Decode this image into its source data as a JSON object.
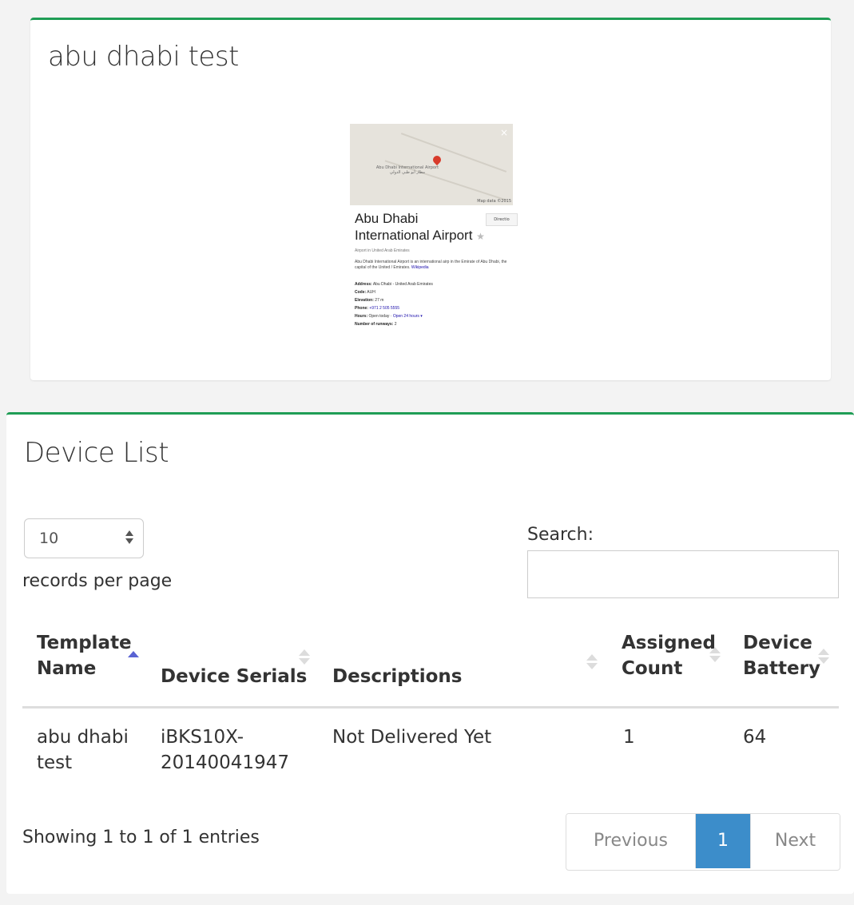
{
  "top_card": {
    "title": "abu dhabi test",
    "image": {
      "map_label": "Abu Dhabi International Airport",
      "map_label_ar": "مطار أبو ظبي الدولي",
      "map_data": "Map data ©2015",
      "close": "×",
      "name_line1": "Abu Dhabi",
      "name_line2": "International Airport",
      "star": "★",
      "directions": "Directio",
      "subtitle": "Airport in United Arab Emirates",
      "description": "Abu Dhabi International Airport is an international airp in the Emirate of Abu Dhabi, the capital of the United / Emirates.",
      "wiki": "Wikipedia",
      "address_label": "Address:",
      "address": "Abu Dhabi - United Arab Emirates",
      "code_label": "Code:",
      "code": "AUH",
      "elevation_label": "Elevation:",
      "elevation": "27 m",
      "phone_label": "Phone:",
      "phone": "+971 2 505 5555",
      "hours_label": "Hours:",
      "hours_status": "Open today ·",
      "hours_link": "Open 24 hours ▾",
      "runways_label": "Number of runways:",
      "runways": "2"
    }
  },
  "device_list": {
    "title": "Device List",
    "length_select": {
      "value": "10",
      "label": "records per page"
    },
    "search": {
      "label": "Search:",
      "value": ""
    },
    "columns": [
      "Template Name",
      "Device Serials",
      "Descriptions",
      "Assigned Count",
      "Device Battery"
    ],
    "column_lines": {
      "template_1": "Template",
      "template_2": "Name",
      "serials": "Device Serials",
      "descriptions": "Descriptions",
      "assigned_1": "Assigned",
      "assigned_2": "Count",
      "battery_1": "Device",
      "battery_2": "Battery"
    },
    "rows": [
      {
        "template_1": "abu dhabi",
        "template_2": "test",
        "serial_1": "iBKS10X-",
        "serial_2": "20140041947",
        "description": "Not Delivered Yet",
        "assigned_count": "1",
        "battery": "64"
      }
    ],
    "info": "Showing 1 to 1 of 1 entries",
    "pagination": {
      "previous": "Previous",
      "current": "1",
      "next": "Next"
    }
  }
}
